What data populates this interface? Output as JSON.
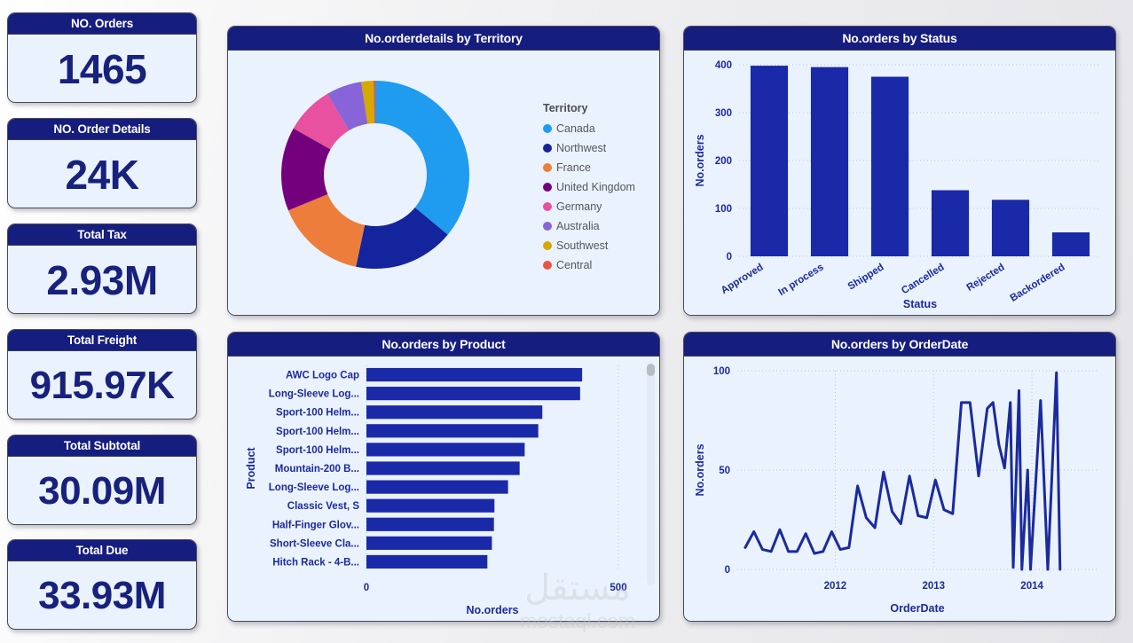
{
  "theme": {
    "header_bg": "#151d7e",
    "panel_bg": "#eaf2fd",
    "value_color": "#18217c",
    "bar_color": "#1a29a8",
    "line_color": "#1b2a9e",
    "page_bg": "#eeeef0"
  },
  "kpis": [
    {
      "title": "NO. Orders",
      "value": "1465"
    },
    {
      "title": "NO. Order Details",
      "value": "24K"
    },
    {
      "title": "Total Tax",
      "value": "2.93M"
    },
    {
      "title": "Total Freight",
      "value": "915.97K"
    },
    {
      "title": "Total Subtotal",
      "value": "30.09M"
    },
    {
      "title": "Total Due",
      "value": "33.93M"
    }
  ],
  "panels": {
    "territory": {
      "title": "No.orderdetails by Territory"
    },
    "status": {
      "title": "No.orders by Status"
    },
    "product": {
      "title": "No.orders by Product"
    },
    "orderdate": {
      "title": "No.orders by OrderDate"
    }
  },
  "watermark": {
    "arabic": "مستقل",
    "latin": "mostaql.com"
  },
  "chart_data": [
    {
      "id": "territory",
      "type": "pie",
      "title": "No.orderdetails by Territory",
      "legend_title": "Territory",
      "legend_position": "right",
      "donut": true,
      "labels": [
        "Canada",
        "Northwest",
        "France",
        "United Kingdom",
        "Germany",
        "Australia",
        "Southwest",
        "Central"
      ],
      "values": [
        36.0,
        17.3,
        15.5,
        14.4,
        8.3,
        6.1,
        2.1,
        0.3
      ],
      "colors": [
        "#1f9bf0",
        "#14249c",
        "#ed7d3a",
        "#75007e",
        "#e8519f",
        "#8764d8",
        "#d6a800",
        "#e8563f"
      ]
    },
    {
      "id": "status",
      "type": "bar",
      "title": "No.orders by Status",
      "xlabel": "Status",
      "ylabel": "No.orders",
      "categories": [
        "Approved",
        "In process",
        "Shipped",
        "Cancelled",
        "Rejected",
        "Backordered"
      ],
      "values": [
        398,
        395,
        375,
        138,
        118,
        50
      ],
      "yticks": [
        0,
        100,
        200,
        300,
        400
      ],
      "ylim": [
        0,
        400
      ],
      "grid": true,
      "color": "#1a29a8"
    },
    {
      "id": "product",
      "type": "bar",
      "orientation": "horizontal",
      "title": "No.orders by Product",
      "xlabel": "No.orders",
      "ylabel": "Product",
      "categories": [
        "AWC Logo Cap",
        "Long-Sleeve Log...",
        "Sport-100 Helm...",
        "Sport-100 Helm...",
        "Sport-100 Helm...",
        "Mountain-200 B...",
        "Long-Sleeve Log...",
        "Classic Vest, S",
        "Half-Finger Glov...",
        "Short-Sleeve Cla...",
        "Hitch Rack - 4-B..."
      ],
      "values": [
        428,
        424,
        349,
        341,
        314,
        304,
        281,
        254,
        253,
        249,
        240
      ],
      "xticks": [
        0,
        500
      ],
      "xlim": [
        0,
        500
      ],
      "grid": true,
      "color": "#1a29a8",
      "has_scrollbar": true
    },
    {
      "id": "orderdate",
      "type": "line",
      "title": "No.orders by OrderDate",
      "xlabel": "OrderDate",
      "ylabel": "No.orders",
      "xticks": [
        "2012",
        "2013",
        "2014"
      ],
      "yticks": [
        0,
        50,
        100
      ],
      "ylim": [
        0,
        100
      ],
      "grid": true,
      "color": "#1b2a9e",
      "values": [
        11,
        19,
        10,
        9,
        20,
        9,
        9,
        18,
        8,
        9,
        19,
        10,
        11,
        42,
        26,
        21,
        49,
        29,
        23,
        47,
        27,
        26,
        45,
        30,
        28,
        84,
        84,
        47,
        81,
        84,
        63,
        51,
        84,
        1,
        90,
        0,
        50,
        0,
        85,
        0,
        99,
        0
      ],
      "x_positions": [
        0.022,
        0.046,
        0.07,
        0.094,
        0.118,
        0.142,
        0.166,
        0.19,
        0.214,
        0.238,
        0.262,
        0.286,
        0.31,
        0.334,
        0.358,
        0.382,
        0.406,
        0.43,
        0.454,
        0.478,
        0.502,
        0.526,
        0.55,
        0.574,
        0.598,
        0.622,
        0.646,
        0.67,
        0.694,
        0.71,
        0.726,
        0.742,
        0.758,
        0.766,
        0.782,
        0.79,
        0.806,
        0.814,
        0.842,
        0.862,
        0.886,
        0.896
      ]
    }
  ]
}
